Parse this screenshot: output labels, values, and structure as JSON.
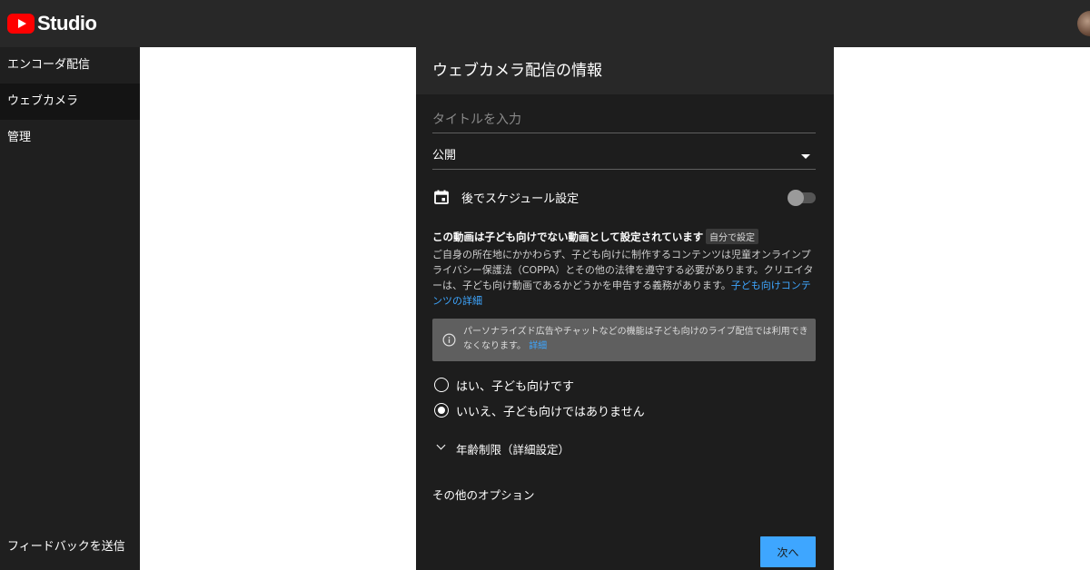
{
  "app": {
    "logo_text": "Studio"
  },
  "sidebar": {
    "items": [
      {
        "label": "エンコーダ配信"
      },
      {
        "label": "ウェブカメラ"
      },
      {
        "label": "管理"
      }
    ],
    "feedback_label": "フィードバックを送信"
  },
  "dialog": {
    "title": "ウェブカメラ配信の情報",
    "title_input": {
      "placeholder": "タイトルを入力",
      "value": ""
    },
    "visibility": {
      "selected": "公開"
    },
    "schedule": {
      "label": "後でスケジュール設定",
      "enabled": false
    },
    "kids": {
      "heading": "この動画は子ども向けでない動画として設定されています",
      "badge": "自分で設定",
      "description": "ご自身の所在地にかかわらず、子ども向けに制作するコンテンツは児童オンラインプライバシー保護法（COPPA）とその他の法律を遵守する必要があります。クリエイターは、子ども向け動画であるかどうかを申告する義務があります。",
      "description_link": "子ども向けコンテンツの詳細",
      "info_text": "パーソナライズド広告やチャットなどの機能は子ども向けのライブ配信では利用できなくなります。",
      "info_link": "詳細",
      "options": [
        {
          "label": "はい、子ども向けです",
          "checked": false
        },
        {
          "label": "いいえ、子ども向けではありません",
          "checked": true
        }
      ]
    },
    "age_restriction_label": "年齢制限（詳細設定）",
    "other_options_label": "その他のオプション",
    "next_label": "次へ"
  },
  "colors": {
    "topbar": "#282828",
    "sidebar": "#1f1f1f",
    "panel": "#1d1d1d",
    "accent": "#3ea6ff",
    "youtube_red": "#ff0000"
  },
  "icons": [
    "youtube-logo-icon",
    "avatar",
    "calendar-icon",
    "dropdown-caret-icon",
    "info-icon",
    "chevron-down-icon"
  ]
}
